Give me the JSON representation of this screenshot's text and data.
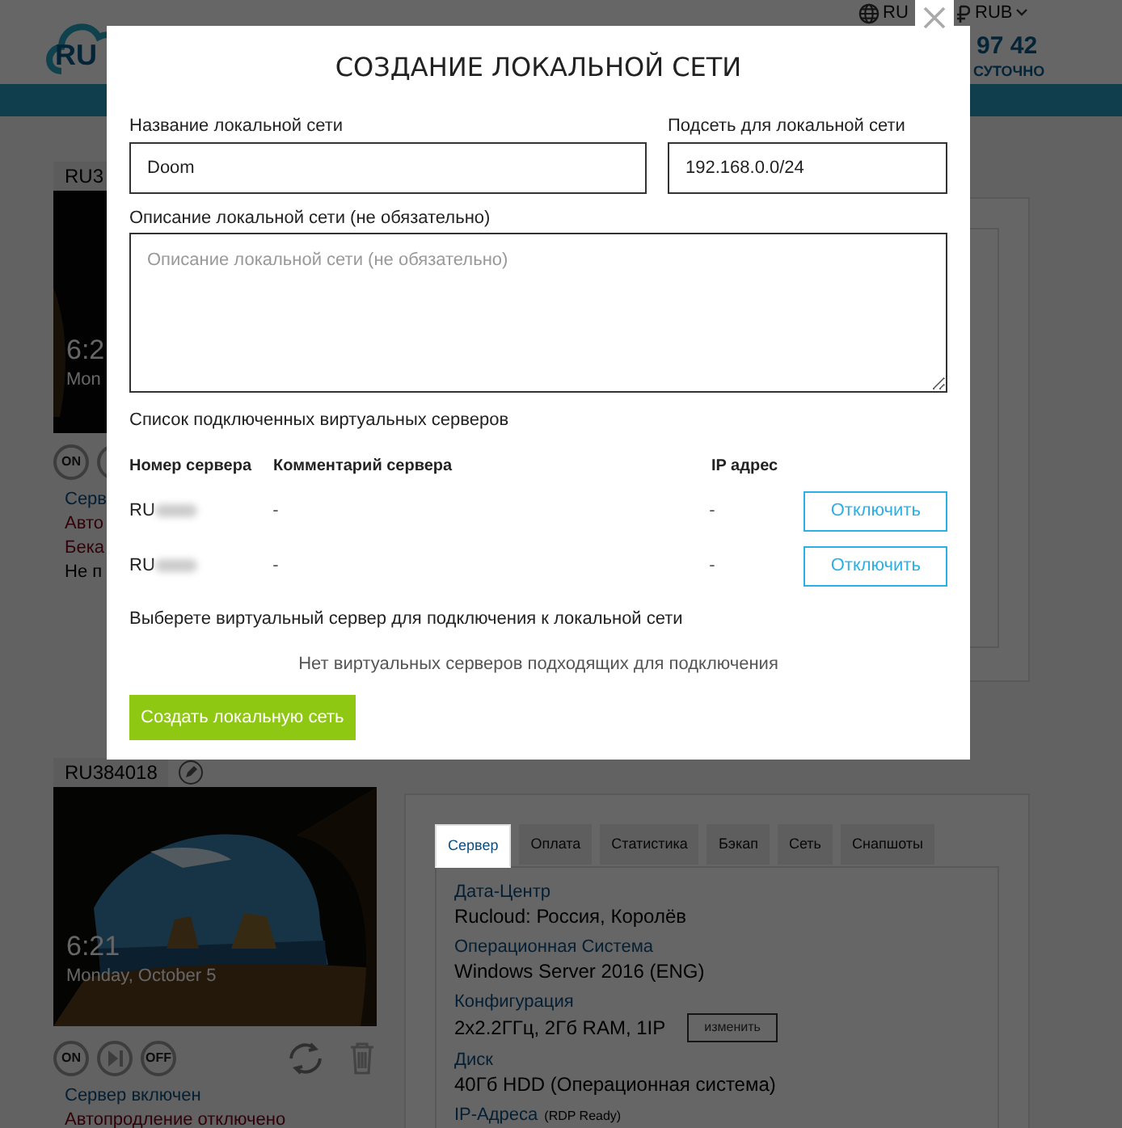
{
  "header": {
    "logo_text": "RU",
    "language": "RU",
    "currency": "RUB",
    "phone": "97 42",
    "phone_note": "СУТОЧНО"
  },
  "servers": [
    {
      "id": "RU3",
      "screen_time": "6:2",
      "screen_date": "Mon",
      "controls": [
        {
          "kind": "text",
          "label": "ON"
        },
        {
          "kind": "icon"
        }
      ],
      "status_lines": [
        {
          "text": "Серв",
          "kind": "info"
        },
        {
          "text": "Авто",
          "kind": "warning"
        },
        {
          "text": "Бека",
          "kind": "warning"
        },
        {
          "text": "Не п",
          "kind": "plain"
        }
      ]
    },
    {
      "id": "RU384018",
      "screen_time": "6:21",
      "screen_date": "Monday, October 5",
      "edit": true,
      "tools": true,
      "controls": [
        {
          "kind": "text",
          "label": "ON"
        },
        {
          "kind": "icon"
        },
        {
          "kind": "text",
          "label": "OFF"
        }
      ],
      "status_lines": [
        {
          "text": "Сервер включен",
          "kind": "info"
        },
        {
          "text": "Автопродление отключено",
          "kind": "warning"
        }
      ],
      "tabs": [
        {
          "label": "Сервер",
          "selected": true
        },
        {
          "label": "Оплата",
          "selected": false
        },
        {
          "label": "Статистика",
          "selected": false
        },
        {
          "label": "Бэкап",
          "selected": false
        },
        {
          "label": "Сеть",
          "selected": false
        },
        {
          "label": "Снапшоты",
          "selected": false
        }
      ],
      "fields": [
        {
          "label": "Дата-Центр",
          "value": "Rucloud: Россия, Королёв"
        },
        {
          "label": "Операционная Система",
          "value": "Windows Server 2016 (ENG)"
        },
        {
          "label": "Конфигурация",
          "value": "2x2.2ГГц, 2Гб RAM, 1IP",
          "action": "изменить"
        },
        {
          "label": "Диск",
          "value": "40Гб HDD (Операционная система)"
        },
        {
          "label": "IP-Адреса",
          "note": "(RDP Ready)"
        }
      ]
    }
  ],
  "modal": {
    "title": "СОЗДАНИЕ ЛОКАЛЬНОЙ СЕТИ",
    "name_field": {
      "label": "Название локальной сети",
      "value": "Doom"
    },
    "subnet_field": {
      "label": "Подсеть для локальной сети",
      "value": "192.168.0.0/24"
    },
    "description_field": {
      "label": "Описание локальной сети (не обязательно)",
      "placeholder": "Описание локальной сети (не обязательно)"
    },
    "connected_title": "Список подключенных виртуальных серверов",
    "columns": [
      "Номер сервера",
      "Комментарий сервера",
      "IP адрес"
    ],
    "rows": [
      {
        "server": "RU",
        "comment": "-",
        "ip": "-",
        "action": "Отключить"
      },
      {
        "server": "RU",
        "comment": "-",
        "ip": "-",
        "action": "Отключить"
      }
    ],
    "select_title": "Выберете виртуальный сервер для подключения к локальной сети",
    "empty_text": "Нет виртуальных серверов подходящих для подключения",
    "submit": "Создать локальную сеть"
  }
}
